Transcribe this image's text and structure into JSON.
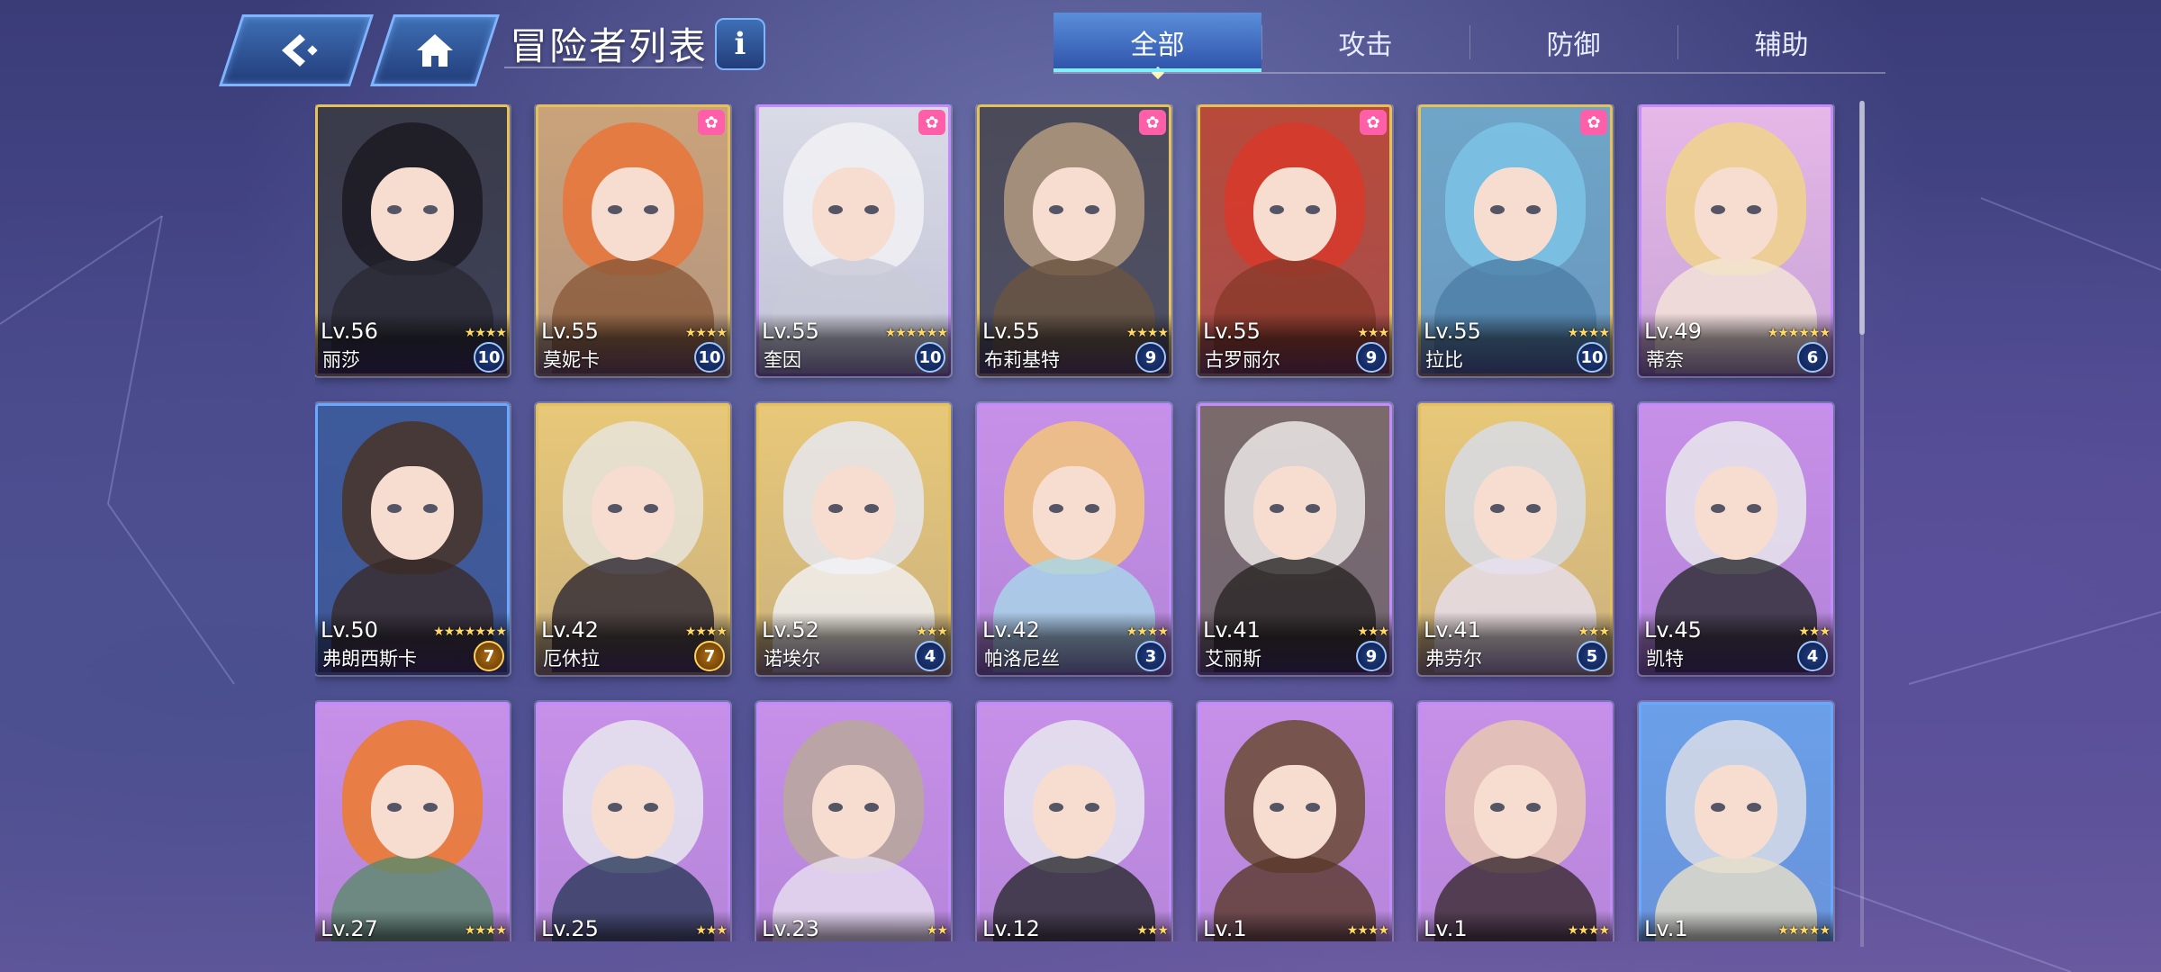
{
  "header": {
    "title": "冒险者列表",
    "info_label": "i"
  },
  "tabs": [
    {
      "label": "全部",
      "active": true
    },
    {
      "label": "攻击",
      "active": false
    },
    {
      "label": "防御",
      "active": false
    },
    {
      "label": "辅助",
      "active": false
    }
  ],
  "colors": {
    "tab_active": "#3f7ad0",
    "frame_gold": "#e6c15a",
    "frame_purple": "#c48bff",
    "frame_blue": "#6aa8ff"
  },
  "cards": [
    {
      "level": "Lv.56",
      "name": "丽莎",
      "stars": "★★★★",
      "rank": "10",
      "rank_style": "blue",
      "paw": false,
      "frame": "gold",
      "bg": "#3a3c4a",
      "hair": "#1c1a22",
      "body": "#2b2a35"
    },
    {
      "level": "Lv.55",
      "name": "莫妮卡",
      "stars": "★★★★",
      "rank": "10",
      "rank_style": "blue",
      "paw": true,
      "frame": "gold",
      "bg": "#caa37a",
      "hair": "#e9743a",
      "body": "#8a5a3a"
    },
    {
      "level": "Lv.55",
      "name": "奎因",
      "stars": "★★★★★★",
      "rank": "10",
      "rank_style": "blue",
      "paw": true,
      "frame": "purple",
      "bg": "#d9dbe6",
      "hair": "#f1f1f4",
      "body": "#c9cbd8"
    },
    {
      "level": "Lv.55",
      "name": "布莉基特",
      "stars": "★★★★",
      "rank": "9",
      "rank_style": "blue",
      "paw": true,
      "frame": "gold",
      "bg": "#4a4a58",
      "hair": "#b39a80",
      "body": "#6a5540"
    },
    {
      "level": "Lv.55",
      "name": "古罗丽尔",
      "stars": "★★★",
      "rank": "9",
      "rank_style": "blue",
      "paw": true,
      "frame": "gold",
      "bg": "#b84a3a",
      "hair": "#d83a2a",
      "body": "#8a3a2a"
    },
    {
      "level": "Lv.55",
      "name": "拉比",
      "stars": "★★★★",
      "rank": "10",
      "rank_style": "blue",
      "paw": true,
      "frame": "gold",
      "bg": "#6fa6c8",
      "hair": "#7cc4e6",
      "body": "#4d7ea6"
    },
    {
      "level": "Lv.49",
      "name": "蒂奈",
      "stars": "★★★★★★",
      "rank": "6",
      "rank_style": "blue",
      "paw": false,
      "frame": "purple",
      "bg": "#e6b8e8",
      "hair": "#f0d38a",
      "body": "#f4e6d8"
    },
    {
      "level": "Lv.50",
      "name": "弗朗西斯卡",
      "stars": "★★★★★★★",
      "rank": "7",
      "rank_style": "gold",
      "paw": false,
      "frame": "blue",
      "bg": "#3d5a9a",
      "hair": "#4a3428",
      "body": "#3a2a2a"
    },
    {
      "level": "Lv.42",
      "name": "厄休拉",
      "stars": "★★★★",
      "rank": "7",
      "rank_style": "gold",
      "paw": false,
      "frame": "gold",
      "bg": "#e8c878",
      "hair": "#e8e4dc",
      "body": "#2a2430"
    },
    {
      "level": "Lv.52",
      "name": "诺埃尔",
      "stars": "★★★",
      "rank": "4",
      "rank_style": "blue",
      "paw": false,
      "frame": "gold",
      "bg": "#e8c878",
      "hair": "#e6e6ee",
      "body": "#f2f2f6"
    },
    {
      "level": "Lv.42",
      "name": "帕洛尼丝",
      "stars": "★★★★",
      "rank": "3",
      "rank_style": "blue",
      "paw": false,
      "frame": "purple",
      "bg": "#c890e8",
      "hair": "#f2c67a",
      "body": "#a8d8ea"
    },
    {
      "level": "Lv.41",
      "name": "艾丽斯",
      "stars": "★★★",
      "rank": "9",
      "rank_style": "blue",
      "paw": false,
      "frame": "purple",
      "bg": "#7a6a6a",
      "hair": "#ece8e6",
      "body": "#2a2626"
    },
    {
      "level": "Lv.41",
      "name": "弗劳尔",
      "stars": "★★★",
      "rank": "5",
      "rank_style": "blue",
      "paw": false,
      "frame": "gold",
      "bg": "#e8c878",
      "hair": "#d8dce6",
      "body": "#e8e0f0"
    },
    {
      "level": "Lv.45",
      "name": "凯特",
      "stars": "★★★",
      "rank": "4",
      "rank_style": "blue",
      "paw": false,
      "frame": "purple",
      "bg": "#c890e8",
      "hair": "#e8e8ec",
      "body": "#2a2a30"
    },
    {
      "level": "Lv.27",
      "name": "",
      "stars": "★★★★",
      "rank": "",
      "rank_style": "blue",
      "paw": false,
      "frame": "purple",
      "bg": "#c890e8",
      "hair": "#ee7a2a",
      "body": "#5a8a6a"
    },
    {
      "level": "Lv.25",
      "name": "",
      "stars": "★★★",
      "rank": "",
      "rank_style": "blue",
      "paw": false,
      "frame": "purple",
      "bg": "#c890e8",
      "hair": "#e8e8ee",
      "body": "#2a3a5a"
    },
    {
      "level": "Lv.23",
      "name": "",
      "stars": "★★",
      "rank": "",
      "rank_style": "blue",
      "paw": false,
      "frame": "purple",
      "bg": "#c890e8",
      "hair": "#b8a89a",
      "body": "#e8e0f0"
    },
    {
      "level": "Lv.12",
      "name": "",
      "stars": "★★★",
      "rank": "",
      "rank_style": "blue",
      "paw": false,
      "frame": "purple",
      "bg": "#c890e8",
      "hair": "#e8e8ee",
      "body": "#2a2a30"
    },
    {
      "level": "Lv.1",
      "name": "",
      "stars": "★★★★",
      "rank": "",
      "rank_style": "blue",
      "paw": false,
      "frame": "purple",
      "bg": "#c890e8",
      "hair": "#6a4a32",
      "body": "#5a3a2a"
    },
    {
      "level": "Lv.1",
      "name": "",
      "stars": "★★★★",
      "rank": "",
      "rank_style": "blue",
      "paw": false,
      "frame": "purple",
      "bg": "#c890e8",
      "hair": "#e8c8b0",
      "body": "#3a2a30"
    },
    {
      "level": "Lv.1",
      "name": "",
      "stars": "★★★★★",
      "rank": "",
      "rank_style": "blue",
      "paw": false,
      "frame": "blue",
      "bg": "#6aa0e8",
      "hair": "#d8dce8",
      "body": "#e8e0c8"
    }
  ]
}
